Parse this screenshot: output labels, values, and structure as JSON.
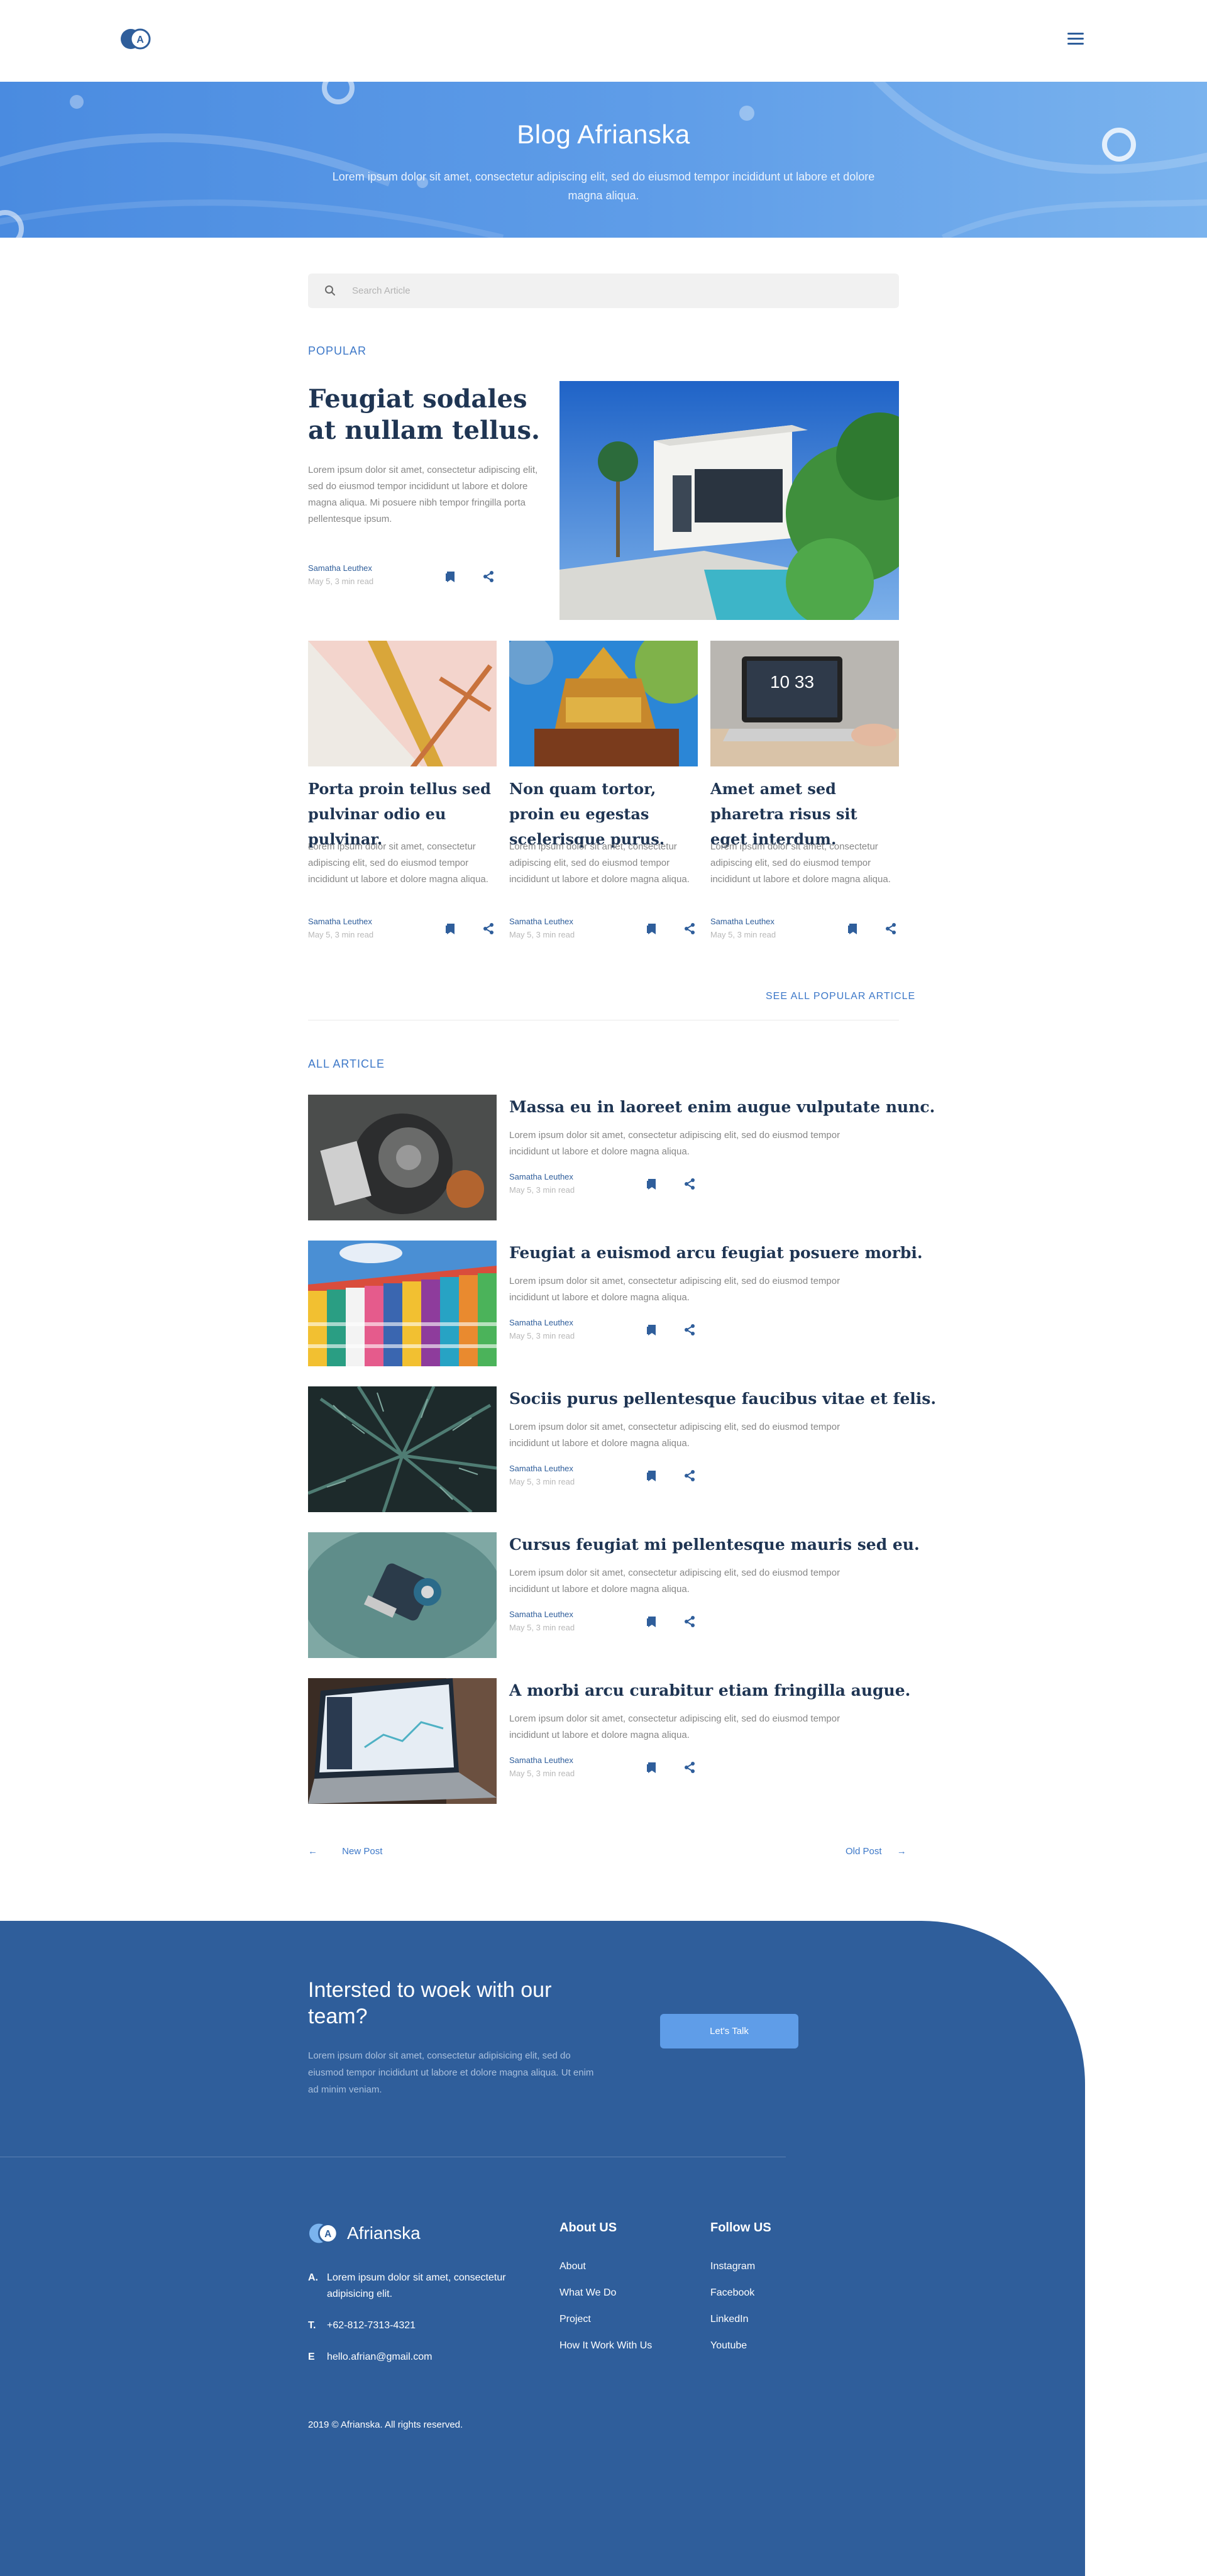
{
  "brand": {
    "logo_letter": "A",
    "name": "Afrianska"
  },
  "hero": {
    "title": "Blog Afrianska",
    "subtitle": "Lorem ipsum dolor sit amet, consectetur adipiscing elit, sed do eiusmod tempor incididunt ut labore et dolore magna aliqua."
  },
  "search": {
    "placeholder": "Search Article"
  },
  "popular": {
    "label": "POPULAR",
    "featured": {
      "title": "Feugiat sodales at nullam tellus.",
      "excerpt": "Lorem ipsum dolor sit amet, consectetur adipiscing elit, sed do eiusmod tempor incididunt ut labore et dolore magna aliqua. Mi posuere nibh tempor fringilla porta pellentesque ipsum.",
      "author": "Samatha Leuthex",
      "date": "May 5, 3 min read"
    },
    "cards": [
      {
        "title": "Porta proin tellus sed pulvinar odio eu pulvinar.",
        "excerpt": "Lorem ipsum dolor sit amet, consectetur adipiscing elit, sed do eiusmod tempor incididunt ut labore et dolore magna aliqua.",
        "author": "Samatha Leuthex",
        "date": "May 5, 3 min read"
      },
      {
        "title": "Non quam tortor, proin eu egestas scelerisque purus.",
        "excerpt": "Lorem ipsum dolor sit amet, consectetur adipiscing elit, sed do eiusmod tempor incididunt ut labore et dolore magna aliqua.",
        "author": "Samatha Leuthex",
        "date": "May 5, 3 min read"
      },
      {
        "title": "Amet amet sed pharetra risus sit eget interdum.",
        "excerpt": "Lorem ipsum dolor sit amet, consectetur adipiscing elit, sed do eiusmod tempor incididunt ut labore et dolore magna aliqua.",
        "author": "Samatha Leuthex",
        "date": "May 5, 3 min read"
      }
    ],
    "see_all": "SEE ALL POPULAR ARTICLE"
  },
  "all_articles": {
    "label": "ALL ARTICLE",
    "items": [
      {
        "title": "Massa eu in laoreet enim augue vulputate nunc.",
        "excerpt": "Lorem ipsum dolor sit amet, consectetur adipiscing elit, sed do eiusmod tempor incididunt ut labore et dolore magna aliqua.",
        "author": "Samatha Leuthex",
        "date": "May 5, 3 min read"
      },
      {
        "title": "Feugiat a euismod arcu feugiat posuere morbi.",
        "excerpt": "Lorem ipsum dolor sit amet, consectetur adipiscing elit, sed do eiusmod tempor incididunt ut labore et dolore magna aliqua.",
        "author": "Samatha Leuthex",
        "date": "May 5, 3 min read"
      },
      {
        "title": "Sociis purus pellentesque faucibus vitae et felis.",
        "excerpt": "Lorem ipsum dolor sit amet, consectetur adipiscing elit, sed do eiusmod tempor incididunt ut labore et dolore magna aliqua.",
        "author": "Samatha Leuthex",
        "date": "May 5, 3 min read"
      },
      {
        "title": "Cursus feugiat mi pellentesque mauris sed eu.",
        "excerpt": "Lorem ipsum dolor sit amet, consectetur adipiscing elit, sed do eiusmod tempor incididunt ut labore et dolore magna aliqua.",
        "author": "Samatha Leuthex",
        "date": "May 5, 3 min read"
      },
      {
        "title": "A morbi arcu curabitur etiam fringilla augue.",
        "excerpt": "Lorem ipsum dolor sit amet, consectetur adipiscing elit, sed do eiusmod tempor incididunt ut labore et dolore magna aliqua.",
        "author": "Samatha Leuthex",
        "date": "May 5, 3 min read"
      }
    ]
  },
  "pagination": {
    "newer": "New Post",
    "older": "Old Post"
  },
  "cta": {
    "title": "Intersted to woek with our team?",
    "text": "Lorem ipsum dolor sit amet, consectetur adipisicing elit, sed do eiusmod tempor incididunt ut labore et dolore magna aliqua. Ut enim ad minim veniam.",
    "button": "Let's Talk"
  },
  "footer": {
    "contact": [
      {
        "key": "A.",
        "value": "Lorem ipsum dolor sit amet, consectetur adipisicing elit."
      },
      {
        "key": "T.",
        "value": "+62-812-7313-4321"
      },
      {
        "key": "E",
        "value": "hello.afrian@gmail.com"
      }
    ],
    "about_heading": "About US",
    "about_links": [
      "About",
      "What We Do",
      "Project",
      "How It Work With Us"
    ],
    "follow_heading": "Follow US",
    "follow_links": [
      "Instagram",
      "Facebook",
      "LinkedIn",
      "Youtube"
    ],
    "copyright": "2019 © Afrianska. All rights reserved."
  },
  "colors": {
    "primary": "#2f5e9b",
    "accent": "#3d78c8",
    "hero_start": "#4a8be0",
    "hero_end": "#7ab3ee",
    "button": "#5f9de8"
  },
  "icons": [
    "logo-icon",
    "menu-icon",
    "search-icon",
    "bookmark-icon",
    "share-icon",
    "arrow-left-icon",
    "arrow-right-icon"
  ]
}
